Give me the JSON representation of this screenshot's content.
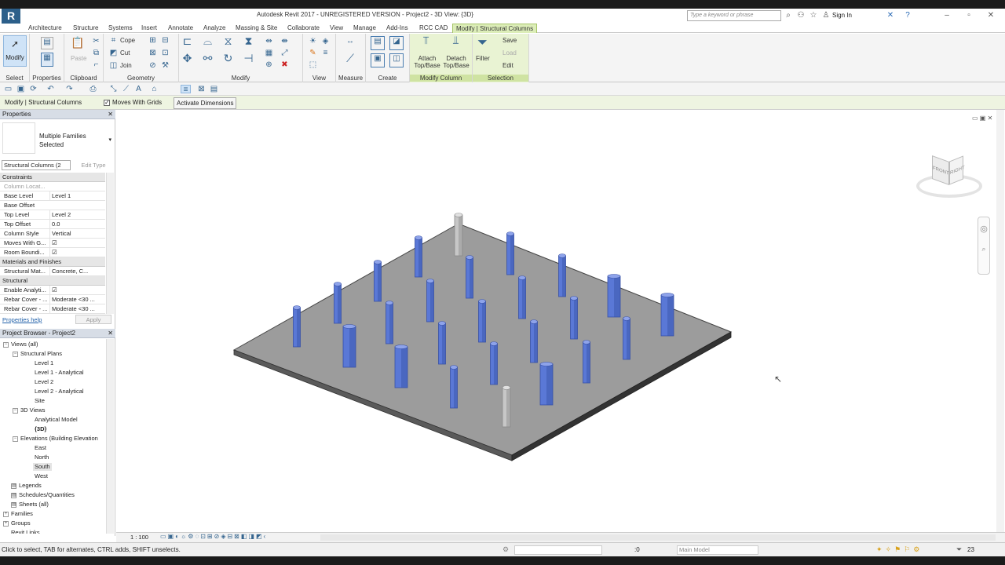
{
  "window": {
    "title": "Autodesk Revit 2017 - UNREGISTERED VERSION -    Project2 - 3D View: {3D}",
    "app_letter": "R"
  },
  "search": {
    "placeholder": "Type a keyword or phrase"
  },
  "signin": "Sign In",
  "tabs": [
    "Architecture",
    "Structure",
    "Systems",
    "Insert",
    "Annotate",
    "Analyze",
    "Massing & Site",
    "Collaborate",
    "View",
    "Manage",
    "Add-Ins",
    "RCC CAD",
    "Modify | Structural Columns"
  ],
  "ribbon": {
    "panels": [
      "Select",
      "Properties",
      "Clipboard",
      "Geometry",
      "Modify",
      "View",
      "Measure",
      "Create",
      "Modify Column",
      "Selection"
    ],
    "modify_label": "Modify",
    "paste_label": "Paste",
    "cope": "Cope",
    "cut": "Cut",
    "join": "Join",
    "attach": "Attach Top/Base",
    "detach": "Detach Top/Base",
    "filter": "Filter",
    "save": "Save",
    "load": "Load",
    "edit": "Edit"
  },
  "options_bar": {
    "context": "Modify | Structural Columns",
    "moves_with_grids": "Moves With Grids",
    "activate_dimensions": "Activate Dimensions"
  },
  "properties": {
    "title": "Properties",
    "type_name": "Multiple Families Selected",
    "filter": "Structural Columns (2",
    "edit_type": "Edit Type",
    "sections": {
      "constraints": "Constraints",
      "materials": "Materials and Finishes",
      "structural": "Structural"
    },
    "rows": [
      {
        "k": "Column Locat...",
        "v": ""
      },
      {
        "k": "Base Level",
        "v": "Level 1"
      },
      {
        "k": "Base Offset",
        "v": ""
      },
      {
        "k": "Top Level",
        "v": "Level 2"
      },
      {
        "k": "Top Offset",
        "v": "0.0"
      },
      {
        "k": "Column Style",
        "v": "Vertical"
      },
      {
        "k": "Moves With G...",
        "v": "☑"
      },
      {
        "k": "Room Boundi...",
        "v": "☑"
      },
      {
        "k": "Structural Mat...",
        "v": "Concrete, C..."
      },
      {
        "k": "Enable Analyti...",
        "v": "☑"
      },
      {
        "k": "Rebar Cover - ...",
        "v": "Moderate <30 ..."
      },
      {
        "k": "Rebar Cover - ...",
        "v": "Moderate <30 ..."
      }
    ],
    "help": "Properties help",
    "apply": "Apply"
  },
  "browser": {
    "title": "Project Browser - Project2",
    "nodes": [
      "Views (all)",
      "Structural Plans",
      "Level 1",
      "Level 1 - Analytical",
      "Level 2",
      "Level 2 - Analytical",
      "Site",
      "3D Views",
      "Analytical Model",
      "{3D}",
      "Elevations (Building Elevation",
      "East",
      "North",
      "South",
      "West",
      "Legends",
      "Schedules/Quantities",
      "Sheets (all)",
      "Families",
      "Groups",
      "Revit Links"
    ]
  },
  "view_control": {
    "scale": "1 : 100"
  },
  "status": {
    "hint": "Click to select, TAB for alternates, CTRL adds, SHIFT unselects.",
    "model": "Main Model",
    "selected_count": "23",
    "zero": ":0"
  },
  "viewcube": {
    "front": "FRONT",
    "right": "RIGHT"
  }
}
